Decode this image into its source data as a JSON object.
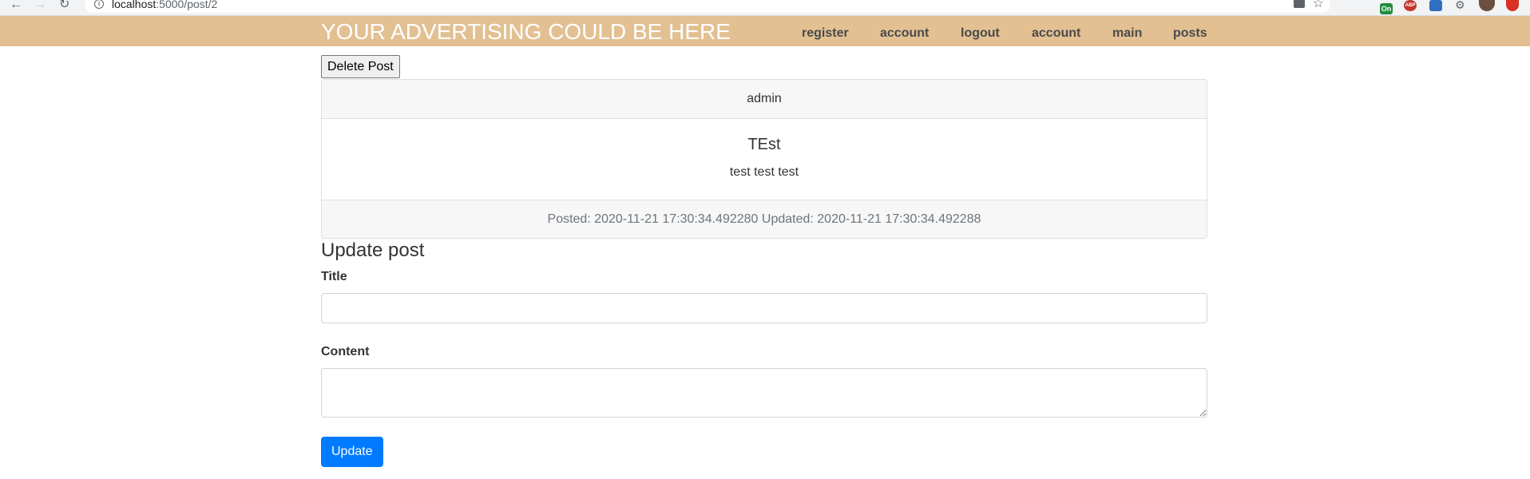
{
  "browser": {
    "url_host": "localhost",
    "url_path": ":5000/post/2",
    "extension_badge": "On",
    "adblock_label": "ABP"
  },
  "navbar": {
    "brand": "YOUR ADVERTISING COULD BE HERE",
    "links": [
      {
        "label": "register"
      },
      {
        "label": "account"
      },
      {
        "label": "logout"
      },
      {
        "label": "account"
      },
      {
        "label": "main"
      },
      {
        "label": "posts"
      }
    ],
    "colors": {
      "background": "#e2c092",
      "brand_text": "#ffffff"
    }
  },
  "delete_button": {
    "label": "Delete Post"
  },
  "post": {
    "author": "admin",
    "title": "TEst",
    "content": "test test test",
    "footer": "Posted: 2020-11-21 17:30:34.492280 Updated: 2020-11-21 17:30:34.492288"
  },
  "update_form": {
    "heading": "Update post",
    "title_label": "Title",
    "title_value": "",
    "content_label": "Content",
    "content_value": "",
    "submit_label": "Update",
    "colors": {
      "submit": "#007bff"
    }
  }
}
